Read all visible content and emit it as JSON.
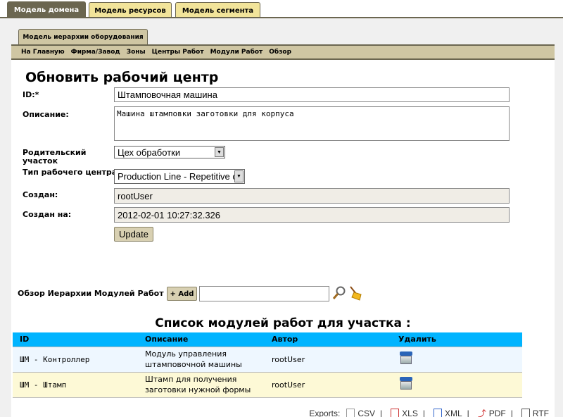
{
  "top_tabs": [
    "Модель домена",
    "Модель ресурсов",
    "Модель сегмента"
  ],
  "sub_tab": "Модель иерархии оборудования",
  "nav": [
    "На Главную",
    "Фирма/Завод",
    "Зоны",
    "Центры Работ",
    "Модули Работ",
    "Обзор"
  ],
  "form": {
    "title": "Обновить рабочий центр",
    "id_label": "ID:*",
    "id_value": "Штамповочная машина",
    "desc_label": "Описание:",
    "desc_value": "Машина штамповки заготовки для корпуса",
    "parent_label_1": "Родительский",
    "parent_label_2": "участок",
    "parent_value": "Цех обработки",
    "type_label": "Тип рабочего центра",
    "type_value": "Production Line - Repetitive c",
    "created_by_label": "Создан:",
    "created_by_value": "rootUser",
    "created_at_label": "Создан на:",
    "created_at_value": "2012-02-01 10:27:32.326",
    "update_button": "Update"
  },
  "browse": {
    "label": "Обзор Иерархии Модулей Работ",
    "add_button": "+ Add",
    "input_value": ""
  },
  "table": {
    "title": "Список модулей работ для участка :",
    "headers": [
      "ID",
      "Описание",
      "Автор",
      "Удалить"
    ],
    "rows": [
      {
        "id": "ШМ - Контроллер",
        "desc_1": "Модуль управления",
        "desc_2": "штамповочной машины",
        "author": "rootUser"
      },
      {
        "id": "ШМ - Штамп",
        "desc_1": "Штамп для получения",
        "desc_2": "заготовки нужной формы",
        "author": "rootUser"
      }
    ]
  },
  "exports": {
    "label": "Exports:",
    "items": [
      "CSV",
      "XLS",
      "XML",
      "PDF",
      "RTF"
    ]
  },
  "colors": {
    "header_bg": "#00b4ff",
    "tab_dark": "#6b6650",
    "tab_light": "#f2e49a",
    "nav_bg": "#cfc6a3"
  }
}
